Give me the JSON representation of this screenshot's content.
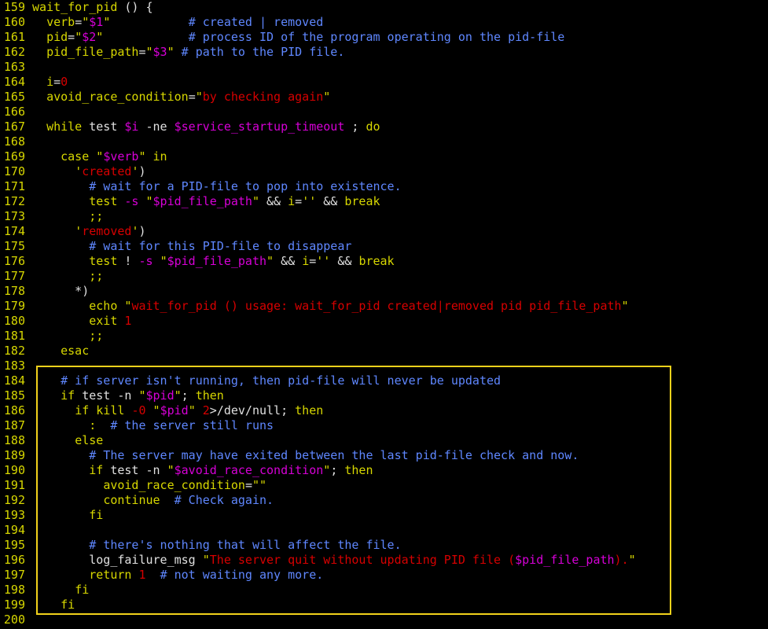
{
  "editor": {
    "highlight_color": "#f2d21b",
    "colors": {
      "line_number": "#d7d700",
      "keyword": "#d7d700",
      "string": "#d70000",
      "variable": "#d700d7",
      "comment": "#5f87ff",
      "plain": "#e0e0e0",
      "background": "#000000"
    },
    "lines": [
      {
        "n": "159",
        "tokens": [
          [
            "func",
            "wait_for_pid"
          ],
          [
            "plain",
            " () {"
          ]
        ]
      },
      {
        "n": "160",
        "tokens": [
          [
            "plain",
            "  "
          ],
          [
            "var",
            "verb"
          ],
          [
            "plain",
            "="
          ],
          [
            "q",
            "\""
          ],
          [
            "dollar",
            "$1"
          ],
          [
            "q",
            "\""
          ],
          [
            "plain",
            "           "
          ],
          [
            "cmt",
            "# created | removed"
          ]
        ]
      },
      {
        "n": "161",
        "tokens": [
          [
            "plain",
            "  "
          ],
          [
            "var",
            "pid"
          ],
          [
            "plain",
            "="
          ],
          [
            "q",
            "\""
          ],
          [
            "dollar",
            "$2"
          ],
          [
            "q",
            "\""
          ],
          [
            "plain",
            "            "
          ],
          [
            "cmt",
            "# process ID of the program operating on the pid-file"
          ]
        ]
      },
      {
        "n": "162",
        "tokens": [
          [
            "plain",
            "  "
          ],
          [
            "var",
            "pid_file_path"
          ],
          [
            "plain",
            "="
          ],
          [
            "q",
            "\""
          ],
          [
            "dollar",
            "$3"
          ],
          [
            "q",
            "\""
          ],
          [
            "plain",
            " "
          ],
          [
            "cmt",
            "# path to the PID file."
          ]
        ]
      },
      {
        "n": "163",
        "tokens": []
      },
      {
        "n": "164",
        "tokens": [
          [
            "plain",
            "  "
          ],
          [
            "var",
            "i"
          ],
          [
            "plain",
            "="
          ],
          [
            "num",
            "0"
          ]
        ]
      },
      {
        "n": "165",
        "tokens": [
          [
            "plain",
            "  "
          ],
          [
            "var",
            "avoid_race_condition"
          ],
          [
            "plain",
            "="
          ],
          [
            "q",
            "\""
          ],
          [
            "str",
            "by checking again"
          ],
          [
            "q",
            "\""
          ]
        ]
      },
      {
        "n": "166",
        "tokens": []
      },
      {
        "n": "167",
        "tokens": [
          [
            "plain",
            "  "
          ],
          [
            "kw",
            "while"
          ],
          [
            "plain",
            " test "
          ],
          [
            "dollar",
            "$i"
          ],
          [
            "plain",
            " -ne "
          ],
          [
            "dollar",
            "$service_startup_timeout"
          ],
          [
            "plain",
            " ; "
          ],
          [
            "kw",
            "do"
          ]
        ]
      },
      {
        "n": "168",
        "tokens": []
      },
      {
        "n": "169",
        "tokens": [
          [
            "plain",
            "    "
          ],
          [
            "kw",
            "case"
          ],
          [
            "plain",
            " "
          ],
          [
            "q",
            "\""
          ],
          [
            "dollar",
            "$verb"
          ],
          [
            "q",
            "\""
          ],
          [
            "plain",
            " "
          ],
          [
            "kw",
            "in"
          ]
        ]
      },
      {
        "n": "170",
        "tokens": [
          [
            "plain",
            "      "
          ],
          [
            "q",
            "'"
          ],
          [
            "str",
            "created"
          ],
          [
            "q",
            "'"
          ],
          [
            "plain",
            ")"
          ]
        ]
      },
      {
        "n": "171",
        "tokens": [
          [
            "plain",
            "        "
          ],
          [
            "cmt",
            "# wait for a PID-file to pop into existence."
          ]
        ]
      },
      {
        "n": "172",
        "tokens": [
          [
            "plain",
            "        "
          ],
          [
            "kw",
            "test"
          ],
          [
            "plain",
            " "
          ],
          [
            "flag",
            "-s"
          ],
          [
            "plain",
            " "
          ],
          [
            "q",
            "\""
          ],
          [
            "dollar",
            "$pid_file_path"
          ],
          [
            "q",
            "\""
          ],
          [
            "plain",
            " && "
          ],
          [
            "var",
            "i"
          ],
          [
            "plain",
            "="
          ],
          [
            "q",
            "''"
          ],
          [
            "plain",
            " && "
          ],
          [
            "kw",
            "break"
          ]
        ]
      },
      {
        "n": "173",
        "tokens": [
          [
            "plain",
            "        "
          ],
          [
            "kw",
            ";;"
          ]
        ]
      },
      {
        "n": "174",
        "tokens": [
          [
            "plain",
            "      "
          ],
          [
            "q",
            "'"
          ],
          [
            "str",
            "removed"
          ],
          [
            "q",
            "'"
          ],
          [
            "plain",
            ")"
          ]
        ]
      },
      {
        "n": "175",
        "tokens": [
          [
            "plain",
            "        "
          ],
          [
            "cmt",
            "# wait for this PID-file to disappear"
          ]
        ]
      },
      {
        "n": "176",
        "tokens": [
          [
            "plain",
            "        "
          ],
          [
            "kw",
            "test"
          ],
          [
            "plain",
            " ! "
          ],
          [
            "flag",
            "-s"
          ],
          [
            "plain",
            " "
          ],
          [
            "q",
            "\""
          ],
          [
            "dollar",
            "$pid_file_path"
          ],
          [
            "q",
            "\""
          ],
          [
            "plain",
            " && "
          ],
          [
            "var",
            "i"
          ],
          [
            "plain",
            "="
          ],
          [
            "q",
            "''"
          ],
          [
            "plain",
            " && "
          ],
          [
            "kw",
            "break"
          ]
        ]
      },
      {
        "n": "177",
        "tokens": [
          [
            "plain",
            "        "
          ],
          [
            "kw",
            ";;"
          ]
        ]
      },
      {
        "n": "178",
        "tokens": [
          [
            "plain",
            "      *)"
          ]
        ]
      },
      {
        "n": "179",
        "tokens": [
          [
            "plain",
            "        "
          ],
          [
            "kw",
            "echo"
          ],
          [
            "plain",
            " "
          ],
          [
            "q",
            "\""
          ],
          [
            "str",
            "wait_for_pid () usage: wait_for_pid created|removed pid pid_file_path"
          ],
          [
            "q",
            "\""
          ]
        ]
      },
      {
        "n": "180",
        "tokens": [
          [
            "plain",
            "        "
          ],
          [
            "kw",
            "exit"
          ],
          [
            "plain",
            " "
          ],
          [
            "num",
            "1"
          ]
        ]
      },
      {
        "n": "181",
        "tokens": [
          [
            "plain",
            "        "
          ],
          [
            "kw",
            ";;"
          ]
        ]
      },
      {
        "n": "182",
        "tokens": [
          [
            "plain",
            "    "
          ],
          [
            "kw",
            "esac"
          ]
        ]
      },
      {
        "n": "183",
        "tokens": []
      },
      {
        "n": "184",
        "tokens": [
          [
            "plain",
            "    "
          ],
          [
            "cmt",
            "# if server isn't running, then pid-file will never be updated"
          ]
        ]
      },
      {
        "n": "185",
        "tokens": [
          [
            "plain",
            "    "
          ],
          [
            "kw",
            "if"
          ],
          [
            "plain",
            " test -n "
          ],
          [
            "q",
            "\""
          ],
          [
            "dollar",
            "$pid"
          ],
          [
            "q",
            "\""
          ],
          [
            "plain",
            "; "
          ],
          [
            "kw",
            "then"
          ]
        ]
      },
      {
        "n": "186",
        "tokens": [
          [
            "plain",
            "      "
          ],
          [
            "kw",
            "if"
          ],
          [
            "plain",
            " "
          ],
          [
            "kw",
            "kill"
          ],
          [
            "plain",
            " "
          ],
          [
            "num",
            "-0"
          ],
          [
            "plain",
            " "
          ],
          [
            "q",
            "\""
          ],
          [
            "dollar",
            "$pid"
          ],
          [
            "q",
            "\""
          ],
          [
            "plain",
            " "
          ],
          [
            "num",
            "2"
          ],
          [
            "plain",
            ">/dev/null; "
          ],
          [
            "kw",
            "then"
          ]
        ]
      },
      {
        "n": "187",
        "tokens": [
          [
            "plain",
            "        "
          ],
          [
            "kw",
            ":"
          ],
          [
            "plain",
            "  "
          ],
          [
            "cmt",
            "# the server still runs"
          ]
        ]
      },
      {
        "n": "188",
        "tokens": [
          [
            "plain",
            "      "
          ],
          [
            "kw",
            "else"
          ]
        ]
      },
      {
        "n": "189",
        "tokens": [
          [
            "plain",
            "        "
          ],
          [
            "cmt",
            "# The server may have exited between the last pid-file check and now."
          ]
        ]
      },
      {
        "n": "190",
        "tokens": [
          [
            "plain",
            "        "
          ],
          [
            "kw",
            "if"
          ],
          [
            "plain",
            " test -n "
          ],
          [
            "q",
            "\""
          ],
          [
            "dollar",
            "$avoid_race_condition"
          ],
          [
            "q",
            "\""
          ],
          [
            "plain",
            "; "
          ],
          [
            "kw",
            "then"
          ]
        ]
      },
      {
        "n": "191",
        "tokens": [
          [
            "plain",
            "          "
          ],
          [
            "var",
            "avoid_race_condition"
          ],
          [
            "plain",
            "="
          ],
          [
            "q",
            "\"\""
          ]
        ]
      },
      {
        "n": "192",
        "tokens": [
          [
            "plain",
            "          "
          ],
          [
            "kw",
            "continue"
          ],
          [
            "plain",
            "  "
          ],
          [
            "cmt",
            "# Check again."
          ]
        ]
      },
      {
        "n": "193",
        "tokens": [
          [
            "plain",
            "        "
          ],
          [
            "kw",
            "fi"
          ]
        ]
      },
      {
        "n": "194",
        "tokens": []
      },
      {
        "n": "195",
        "tokens": [
          [
            "plain",
            "        "
          ],
          [
            "cmt",
            "# there's nothing that will affect the file."
          ]
        ]
      },
      {
        "n": "196",
        "tokens": [
          [
            "plain",
            "        log_failure_msg "
          ],
          [
            "q",
            "\""
          ],
          [
            "str",
            "The server quit without updating PID file ("
          ],
          [
            "dollar",
            "$pid_file_path"
          ],
          [
            "str",
            ")."
          ],
          [
            "q",
            "\""
          ]
        ]
      },
      {
        "n": "197",
        "tokens": [
          [
            "plain",
            "        "
          ],
          [
            "kw",
            "return"
          ],
          [
            "plain",
            " "
          ],
          [
            "num",
            "1"
          ],
          [
            "plain",
            "  "
          ],
          [
            "cmt",
            "# not waiting any more."
          ]
        ]
      },
      {
        "n": "198",
        "tokens": [
          [
            "plain",
            "      "
          ],
          [
            "kw",
            "fi"
          ]
        ]
      },
      {
        "n": "199",
        "tokens": [
          [
            "plain",
            "    "
          ],
          [
            "kw",
            "fi"
          ]
        ]
      },
      {
        "n": "200",
        "tokens": []
      }
    ]
  }
}
